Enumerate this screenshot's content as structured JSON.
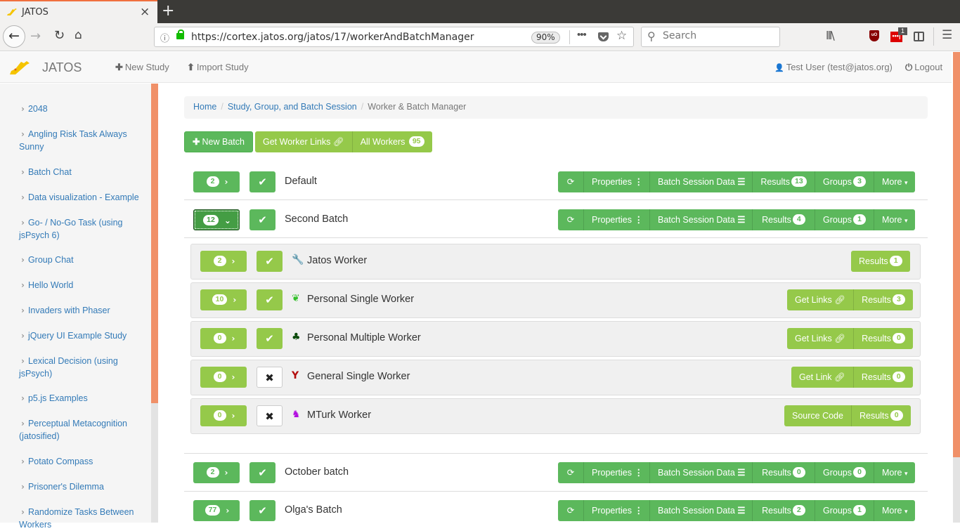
{
  "browser": {
    "tab_title": "JATOS",
    "tab_close": "×",
    "new_tab": "+",
    "back": "←",
    "forward": "→",
    "reload": "↻",
    "home": "⌂",
    "info_icon": "ⓘ",
    "url": "https://cortex.jatos.org/jatos/17/workerAndBatchManager",
    "zoom": "90%",
    "page_actions": "•••",
    "bookmark_star": "☆",
    "search_placeholder": "Search",
    "search_icon": "⚲",
    "library": "lll\\",
    "ublock": "uO",
    "lastpass": "•••|",
    "lastpass_badge": "1",
    "menu": "☰"
  },
  "app": {
    "brand": "JATOS",
    "nav": {
      "new_study": "New Study",
      "new_study_icon": "✚",
      "import_study": "Import Study",
      "import_study_icon": "⬆",
      "user": "Test User (test@jatos.org)",
      "user_icon": "👤",
      "logout": "Logout",
      "logout_icon": "⏻"
    }
  },
  "sidebar": {
    "chevron": "›",
    "studies": [
      "2048",
      "Angling Risk Task Always Sunny",
      "Batch Chat",
      "Data visualization - Example",
      "Go- / No-Go Task (using jsPsych 6)",
      "Group Chat",
      "Hello World",
      "Invaders with Phaser",
      "jQuery UI Example Study",
      "Lexical Decision (using jsPsych)",
      "p5.js Examples",
      "Perceptual Metacognition (jatosified)",
      "Potato Compass",
      "Prisoner's Dilemma",
      "Randomize Tasks Between Workers"
    ]
  },
  "breadcrumb": {
    "items": [
      "Home",
      "Study, Group, and Batch Session",
      "Worker & Batch Manager"
    ],
    "separator": "/"
  },
  "toolbar": {
    "new_batch": "New Batch",
    "new_batch_icon": "✚",
    "get_worker_links": "Get Worker Links",
    "link_icon": "🔗",
    "all_workers": "All Workers",
    "all_workers_count": "95"
  },
  "batch_actions": {
    "refresh_icon": "⟳",
    "properties": "Properties",
    "properties_icon": "⋮",
    "batch_session_data": "Batch Session Data",
    "batch_session_icon": "☰",
    "results": "Results",
    "groups": "Groups",
    "more": "More",
    "caret": "▾"
  },
  "toggle_icons": {
    "collapsed": "›",
    "expanded": "⌄",
    "check": "✔",
    "cross": "✖"
  },
  "batches": [
    {
      "name": "Default",
      "workers": "2",
      "active": true,
      "expanded": false,
      "results": "13",
      "groups": "3"
    },
    {
      "name": "Second Batch",
      "workers": "12",
      "active": true,
      "expanded": true,
      "results": "4",
      "groups": "1"
    },
    {
      "name": "October batch",
      "workers": "2",
      "active": true,
      "expanded": false,
      "results": "0",
      "groups": "0"
    },
    {
      "name": "Olga's Batch",
      "workers": "77",
      "active": true,
      "expanded": false,
      "results": "2",
      "groups": "1"
    }
  ],
  "worker_types": [
    {
      "name": "Jatos Worker",
      "icon": "wrench",
      "glyph": "🔧",
      "color": "#f0ad0e",
      "count": "2",
      "enabled": true,
      "link_label": "",
      "results": "1"
    },
    {
      "name": "Personal Single Worker",
      "icon": "leaf",
      "glyph": "❦",
      "color": "#33c02a",
      "count": "10",
      "enabled": true,
      "link_label": "Get Links",
      "results": "3"
    },
    {
      "name": "Personal Multiple Worker",
      "icon": "tree",
      "glyph": "♣",
      "color": "#0b4a0b",
      "count": "0",
      "enabled": true,
      "link_label": "Get Links",
      "results": "0"
    },
    {
      "name": "General Single Worker",
      "icon": "glass",
      "glyph": "Y",
      "color": "#b30d0d",
      "count": "0",
      "enabled": false,
      "link_label": "Get Link",
      "results": "0"
    },
    {
      "name": "MTurk Worker",
      "icon": "chess-knight",
      "glyph": "♞",
      "color": "#b20ce0",
      "count": "0",
      "enabled": false,
      "link_label": "Source Code",
      "results": "0"
    }
  ],
  "colors": {
    "primary_green": "#5cb85c",
    "lime_green": "#95c94a",
    "link_blue": "#337ab7",
    "scrollbar_orange": "#f09068"
  }
}
